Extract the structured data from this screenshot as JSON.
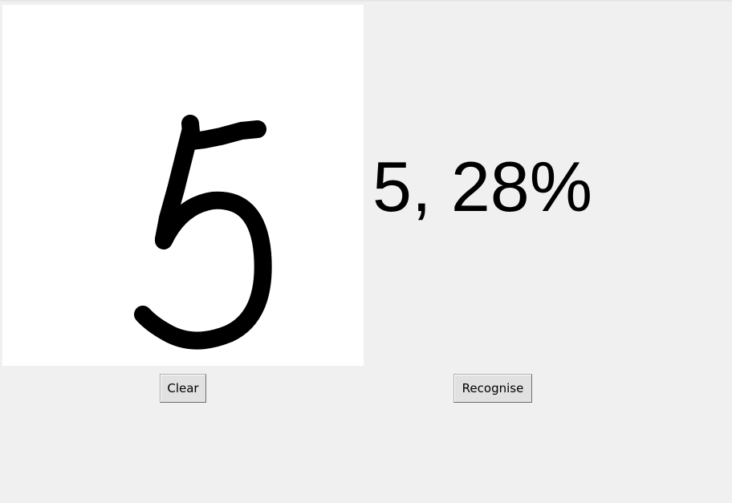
{
  "canvas": {
    "drawn_digit": "5",
    "background_color": "#ffffff",
    "stroke_color": "#000000"
  },
  "result": {
    "text": "5, 28%"
  },
  "buttons": {
    "clear_label": "Clear",
    "recognise_label": "Recognise"
  }
}
